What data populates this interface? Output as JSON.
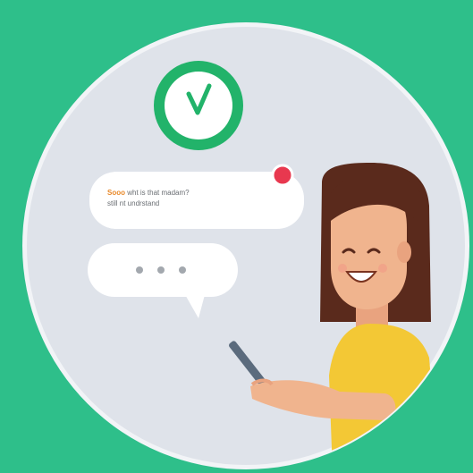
{
  "colors": {
    "background": "#2ebf8a",
    "circle_fill": "#dfe3ea",
    "circle_border": "#f2f4f7",
    "clock_ring": "#22b36a",
    "check": "#22b36a",
    "notification_dot": "#e8384f",
    "highlight_word": "#e8892a",
    "hair": "#5a2a1c",
    "skin": "#f0b48e",
    "shirt": "#f3c835"
  },
  "icons": {
    "clock": "clock-check-icon",
    "typing": "typing-dots-icon",
    "notification": "notification-dot"
  },
  "chat": {
    "message_highlight": "Sooo",
    "message_line1": " wht is that madam?",
    "message_line2": "still nt undrstand"
  }
}
